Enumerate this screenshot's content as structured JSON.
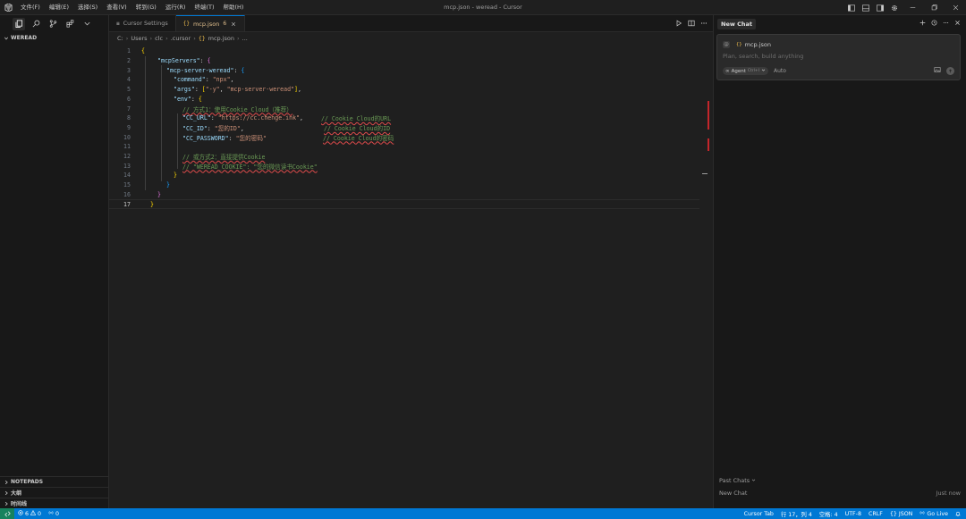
{
  "window": {
    "title": "mcp.json - weread - Cursor",
    "menu": [
      "文件(F)",
      "编辑(E)",
      "选择(S)",
      "查看(V)",
      "转到(G)",
      "运行(R)",
      "终端(T)",
      "帮助(H)"
    ]
  },
  "sidebar": {
    "section": "WEREAD",
    "bottom_sections": [
      "NOTEPADS",
      "大纲",
      "时间线"
    ]
  },
  "tabs": [
    {
      "label": "Cursor Settings",
      "active": false
    },
    {
      "label": "mcp.json",
      "active": true,
      "icon": "{}",
      "problems": "6"
    }
  ],
  "breadcrumb": [
    "C:",
    "Users",
    "clc",
    ".cursor",
    "mcp.json",
    "..."
  ],
  "breadcrumb_icon": "{}",
  "code": {
    "current_line": 17,
    "lines": [
      {
        "n": "1"
      },
      {
        "n": "2"
      },
      {
        "n": "3"
      },
      {
        "n": "4"
      },
      {
        "n": "5"
      },
      {
        "n": "6"
      },
      {
        "n": "7"
      },
      {
        "n": "8"
      },
      {
        "n": "9"
      },
      {
        "n": "10"
      },
      {
        "n": "11"
      },
      {
        "n": "12"
      },
      {
        "n": "13"
      },
      {
        "n": "14"
      },
      {
        "n": "15"
      },
      {
        "n": "16"
      },
      {
        "n": "17"
      }
    ],
    "tokens": {
      "l1_brace": "{",
      "l2_key": "\"mcpServers\"",
      "l2_colon": ": ",
      "l2_brace": "{",
      "l3_key": "\"mcp-server-weread\"",
      "l3_colon": ": ",
      "l3_brace": "{",
      "l4_key": "\"command\"",
      "l4_colon": ": ",
      "l4_val": "\"npx\"",
      "l4_comma": ",",
      "l5_key": "\"args\"",
      "l5_colon": ": ",
      "l5_open": "[",
      "l5_v1": "\"-y\"",
      "l5_mid": ", ",
      "l5_v2": "\"mcp-server-weread\"",
      "l5_close": "]",
      "l5_comma": ",",
      "l6_key": "\"env\"",
      "l6_colon": ": ",
      "l6_brace": "{",
      "l7_comment": "// 方式1：使用Cookie Cloud（推荐）",
      "l8_key": "\"CC_URL\"",
      "l8_colon": ": ",
      "l8_val": "\"https://cc.chenge.ink\"",
      "l8_comma": ",",
      "l8_comment": "// Cookie Cloud的URL",
      "l9_key": "\"CC_ID\"",
      "l9_colon": ": ",
      "l9_val": "\"您的ID\"",
      "l9_comma": ",",
      "l9_comment": "// Cookie Cloud的ID",
      "l10_key": "\"CC_PASSWORD\"",
      "l10_colon": ": ",
      "l10_val": "\"您的密码\"",
      "l10_comment": "// Cookie Cloud的密码",
      "l12_comment": "// 或方式2：直接提供Cookie",
      "l13_comment": "// \"WEREAD_COOKIE\": \"您的微信读书Cookie\"",
      "l14_brace": "}",
      "l15_brace": "}",
      "l16_brace": "}",
      "l17_brace": "}"
    }
  },
  "chat": {
    "tab_label": "New Chat",
    "context_at": "@",
    "context_file": "mcp.json",
    "context_icon": "{}",
    "input_placeholder": "Plan, search, build anything",
    "mode_label": "Agent",
    "mode_kbd": "Ctrl+I",
    "model_label": "Auto",
    "past_chats_label": "Past Chats",
    "past_items": [
      {
        "title": "New Chat",
        "time": "Just now"
      }
    ]
  },
  "statusbar": {
    "errors": "6",
    "warnings": "0",
    "ports": "0",
    "right": [
      "Cursor Tab",
      "行 17，列 4",
      "空格: 4",
      "UTF-8",
      "CRLF",
      "{} JSON",
      "Go Live"
    ]
  },
  "colors": {
    "accent": "#0078d4",
    "remote": "#16825d",
    "error": "#c4262b"
  }
}
